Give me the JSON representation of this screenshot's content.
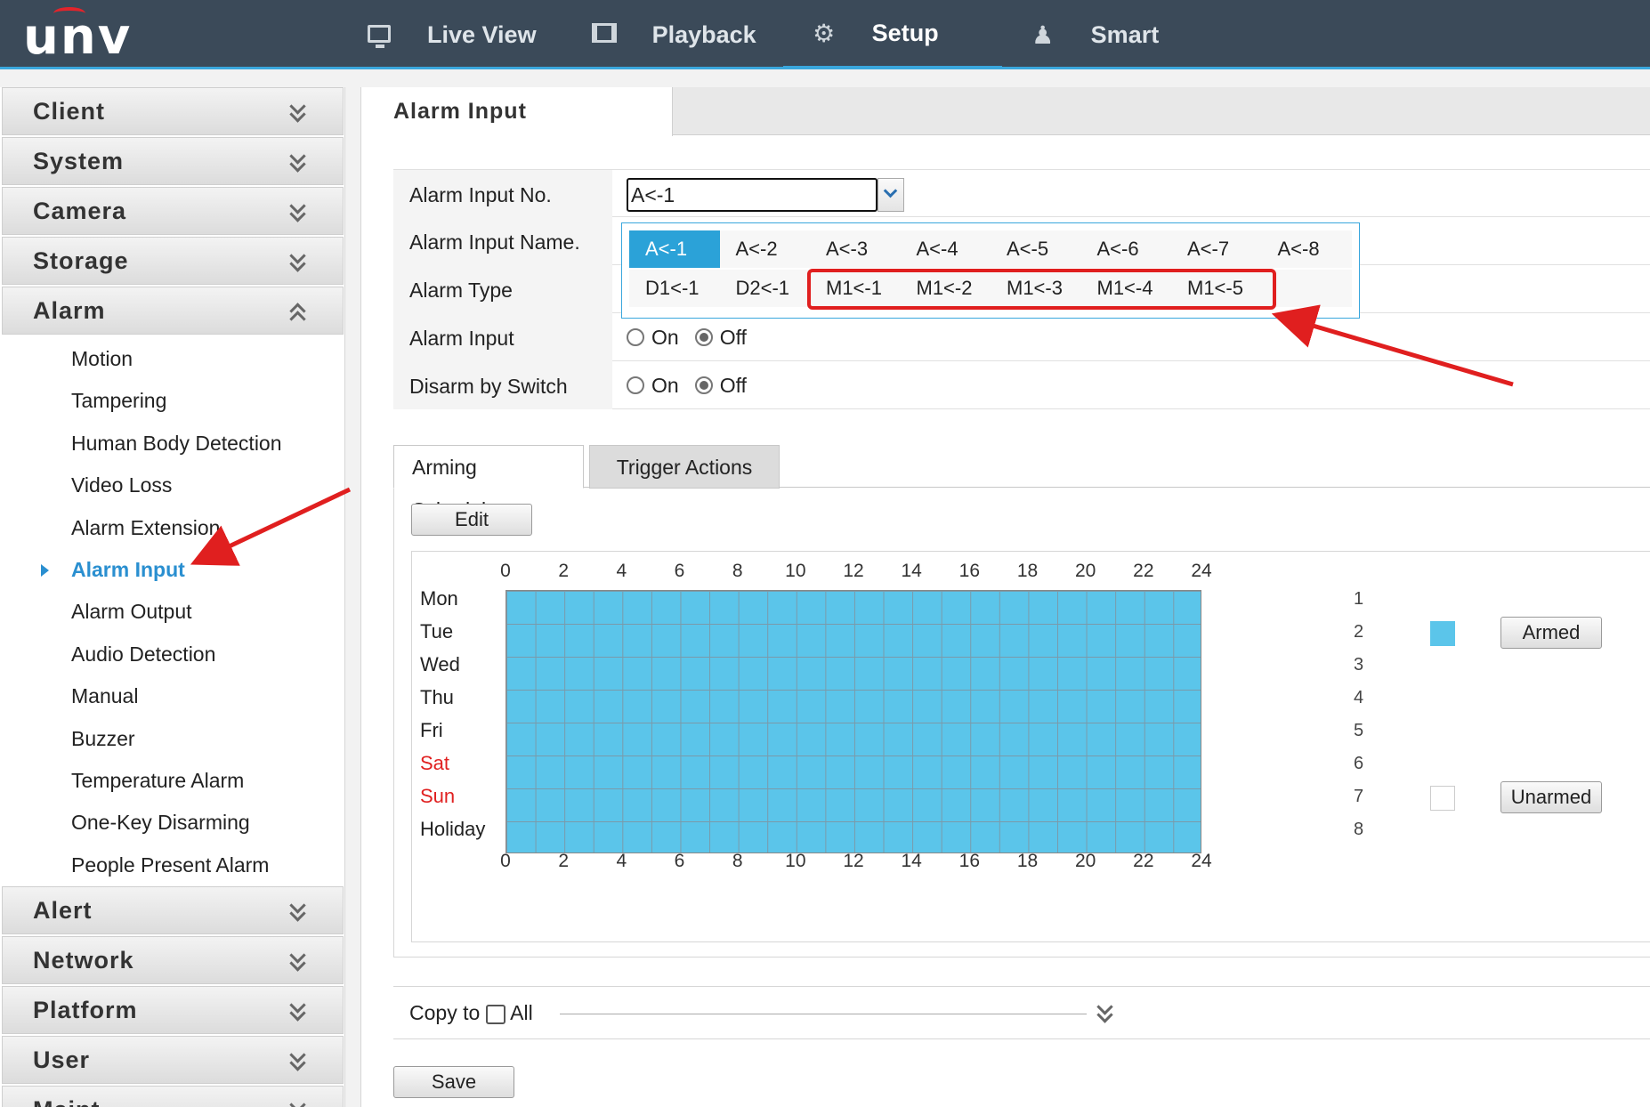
{
  "header": {
    "logo": "unv",
    "nav": [
      {
        "label": "Live View",
        "icon": "monitor-icon"
      },
      {
        "label": "Playback",
        "icon": "film-icon"
      },
      {
        "label": "Setup",
        "icon": "gear-icon",
        "active": true
      },
      {
        "label": "Smart",
        "icon": "user-search-icon"
      }
    ]
  },
  "sidebar": {
    "top_groups": [
      "Client",
      "System",
      "Camera",
      "Storage",
      "Alarm"
    ],
    "alarm_items": [
      "Motion",
      "Tampering",
      "Human Body Detection",
      "Video Loss",
      "Alarm Extension",
      "Alarm Input",
      "Alarm Output",
      "Audio Detection",
      "Manual",
      "Buzzer",
      "Temperature Alarm",
      "One-Key Disarming",
      "People Present Alarm"
    ],
    "active_item": "Alarm Input",
    "bottom_groups": [
      "Alert",
      "Network",
      "Platform",
      "User",
      "Maint..."
    ]
  },
  "page": {
    "title": "Alarm Input",
    "fields": {
      "alarm_input_no_label": "Alarm Input No.",
      "alarm_input_no_value": "A<-1",
      "alarm_input_name_label": "Alarm Input Name.",
      "alarm_type_label": "Alarm Type",
      "alarm_input_label": "Alarm Input",
      "disarm_label": "Disarm by Switch",
      "on": "On",
      "off": "Off"
    },
    "dropdown_options": {
      "row1": [
        "A<-1",
        "A<-2",
        "A<-3",
        "A<-4",
        "A<-5",
        "A<-6",
        "A<-7",
        "A<-8"
      ],
      "row2": [
        "D1<-1",
        "D2<-1",
        "M1<-1",
        "M1<-2",
        "M1<-3",
        "M1<-4",
        "M1<-5"
      ]
    },
    "tabs": [
      "Arming Schedule",
      "Trigger Actions"
    ],
    "edit_label": "Edit",
    "hours": [
      "0",
      "2",
      "4",
      "6",
      "8",
      "10",
      "12",
      "14",
      "16",
      "18",
      "20",
      "22",
      "24"
    ],
    "days": [
      "Mon",
      "Tue",
      "Wed",
      "Thu",
      "Fri",
      "Sat",
      "Sun",
      "Holiday"
    ],
    "row_numbers": [
      "1",
      "2",
      "3",
      "4",
      "5",
      "6",
      "7",
      "8"
    ],
    "legend": {
      "armed": "Armed",
      "unarmed": "Unarmed",
      "armed_color": "#5bc5ea"
    },
    "copy_to": "Copy to",
    "all": "All",
    "save": "Save"
  }
}
